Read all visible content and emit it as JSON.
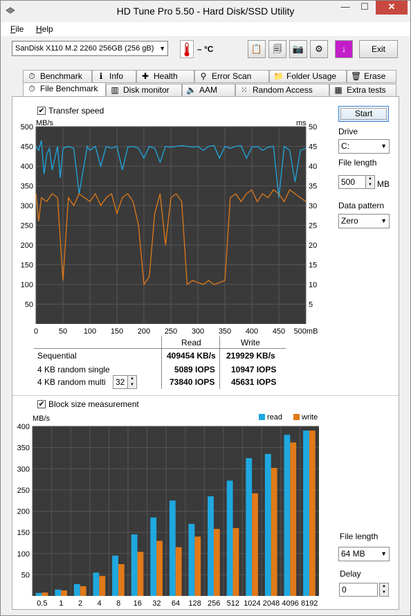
{
  "window": {
    "title": "HD Tune Pro 5.50 - Hard Disk/SSD Utility",
    "min_glyph": "—",
    "max_glyph": "☐",
    "close_glyph": "✕"
  },
  "menu": {
    "file": "File",
    "help": "Help"
  },
  "toolbar": {
    "drive": "SanDisk X110 M.2 2260 256GB (256 gB)",
    "temperature": "– °C",
    "exit_label": "Exit",
    "buttons": [
      {
        "name": "copy-text-icon",
        "glyph": "📋"
      },
      {
        "name": "copy-screenshot-icon",
        "glyph": "🗐"
      },
      {
        "name": "camera-icon",
        "glyph": "📷"
      },
      {
        "name": "options-icon",
        "glyph": "⚙"
      },
      {
        "name": "save-down-icon",
        "glyph": "↓"
      }
    ]
  },
  "tabs_row1": [
    {
      "label": "Benchmark",
      "icon": "benchmark-icon",
      "glyph": "⏱"
    },
    {
      "label": "Info",
      "icon": "info-icon",
      "glyph": "ℹ"
    },
    {
      "label": "Health",
      "icon": "health-icon",
      "glyph": "✚"
    },
    {
      "label": "Error Scan",
      "icon": "error-scan-icon",
      "glyph": "⚲"
    },
    {
      "label": "Folder Usage",
      "icon": "folder-icon",
      "glyph": "📁"
    },
    {
      "label": "Erase",
      "icon": "trash-icon",
      "glyph": "🗑"
    }
  ],
  "tabs_row2": [
    {
      "label": "File Benchmark",
      "icon": "file-benchmark-icon",
      "glyph": "⏱"
    },
    {
      "label": "Disk monitor",
      "icon": "disk-monitor-icon",
      "glyph": "▥"
    },
    {
      "label": "AAM",
      "icon": "speaker-icon",
      "glyph": "🔈"
    },
    {
      "label": "Random Access",
      "icon": "random-access-icon",
      "glyph": "⁙"
    },
    {
      "label": "Extra tests",
      "icon": "extra-tests-icon",
      "glyph": "▦"
    }
  ],
  "transfer": {
    "checkbox_label": "Transfer speed",
    "checked": true,
    "check_glyph": "✔"
  },
  "side": {
    "start_label": "Start",
    "drive_label": "Drive",
    "drive_value": "C:",
    "file_length_label": "File length",
    "file_length_value": "500",
    "file_length_unit": "MB",
    "pattern_label": "Data pattern",
    "pattern_value": "Zero",
    "combo_glyph": "▼"
  },
  "results": {
    "col_read": "Read",
    "col_write": "Write",
    "rows": [
      {
        "label": "Sequential",
        "read": "409454 KB/s",
        "write": "219929 KB/s"
      },
      {
        "label": "4 KB random single",
        "read": "5089 IOPS",
        "write": "10947 IOPS"
      },
      {
        "label": "4 KB random multi",
        "read": "73840 IOPS",
        "write": "45631 IOPS"
      }
    ],
    "queue_depth": "32"
  },
  "block": {
    "checkbox_label": "Block size measurement",
    "checked": true,
    "file_length_label": "File length",
    "file_length_value": "64 MB",
    "delay_label": "Delay",
    "delay_value": "0"
  },
  "colors": {
    "read": "#1fa8e0",
    "write": "#e07a1a",
    "chart_bg": "#3a3a3a",
    "grid": "#555555"
  },
  "chart_data": [
    {
      "type": "line",
      "ylabel_left": "MB/s",
      "ylabel_right": "ms",
      "ylim": [
        0,
        500
      ],
      "ylim_right": [
        0,
        50
      ],
      "xlim": [
        0,
        500
      ],
      "y_ticks": [
        50,
        100,
        150,
        200,
        250,
        300,
        350,
        400,
        450,
        500
      ],
      "y_ticks_right": [
        5,
        10,
        15,
        20,
        25,
        30,
        35,
        40,
        45,
        50
      ],
      "x_ticks": [
        "0",
        "50",
        "100",
        "150",
        "200",
        "250",
        "300",
        "350",
        "400",
        "450",
        "500mB"
      ],
      "grid": true,
      "series": [
        {
          "name": "Read",
          "color": "#1fa8e0",
          "x": [
            0,
            5,
            10,
            15,
            20,
            25,
            30,
            40,
            45,
            50,
            60,
            70,
            80,
            95,
            100,
            110,
            120,
            130,
            140,
            150,
            160,
            170,
            180,
            190,
            200,
            210,
            220,
            230,
            240,
            250,
            260,
            270,
            280,
            290,
            300,
            310,
            320,
            330,
            340,
            350,
            360,
            370,
            380,
            390,
            400,
            410,
            420,
            430,
            440,
            450,
            460,
            470,
            480,
            490,
            500
          ],
          "values": [
            450,
            440,
            465,
            380,
            430,
            445,
            390,
            450,
            370,
            445,
            450,
            445,
            330,
            450,
            440,
            450,
            400,
            450,
            445,
            450,
            390,
            448,
            450,
            445,
            420,
            450,
            445,
            410,
            450,
            448,
            450,
            452,
            450,
            448,
            450,
            440,
            450,
            452,
            420,
            450,
            445,
            450,
            452,
            420,
            448,
            450,
            440,
            448,
            450,
            320,
            450,
            440,
            360,
            440,
            445
          ]
        },
        {
          "name": "Write",
          "color": "#e07a1a",
          "x": [
            0,
            5,
            10,
            20,
            30,
            40,
            50,
            60,
            70,
            80,
            90,
            100,
            110,
            120,
            130,
            140,
            150,
            160,
            170,
            180,
            190,
            200,
            210,
            220,
            230,
            240,
            250,
            260,
            270,
            280,
            290,
            300,
            310,
            320,
            330,
            340,
            350,
            360,
            370,
            380,
            390,
            400,
            410,
            420,
            430,
            440,
            450,
            460,
            470,
            480,
            490,
            500
          ],
          "values": [
            330,
            260,
            320,
            310,
            330,
            320,
            110,
            320,
            300,
            330,
            320,
            310,
            330,
            300,
            320,
            330,
            280,
            320,
            330,
            310,
            250,
            100,
            120,
            280,
            330,
            200,
            320,
            330,
            310,
            100,
            110,
            105,
            100,
            110,
            100,
            105,
            110,
            320,
            330,
            310,
            330,
            340,
            310,
            330,
            320,
            340,
            330,
            310,
            340,
            330,
            320,
            310
          ]
        }
      ]
    },
    {
      "type": "bar",
      "ylabel": "MB/s",
      "ylim": [
        0,
        400
      ],
      "y_ticks": [
        50,
        100,
        150,
        200,
        250,
        300,
        350,
        400
      ],
      "categories": [
        "0.5",
        "1",
        "2",
        "4",
        "8",
        "16",
        "32",
        "64",
        "128",
        "256",
        "512",
        "1024",
        "2048",
        "4096",
        "8192"
      ],
      "grid": true,
      "legend_position": "top-right",
      "series": [
        {
          "name": "read",
          "color": "#1fa8e0",
          "values": [
            7,
            15,
            28,
            55,
            95,
            145,
            185,
            225,
            170,
            235,
            272,
            325,
            335,
            380,
            390
          ]
        },
        {
          "name": "write",
          "color": "#e07a1a",
          "values": [
            8,
            13,
            23,
            47,
            75,
            104,
            130,
            115,
            140,
            158,
            160,
            242,
            302,
            362,
            390
          ]
        }
      ]
    }
  ]
}
